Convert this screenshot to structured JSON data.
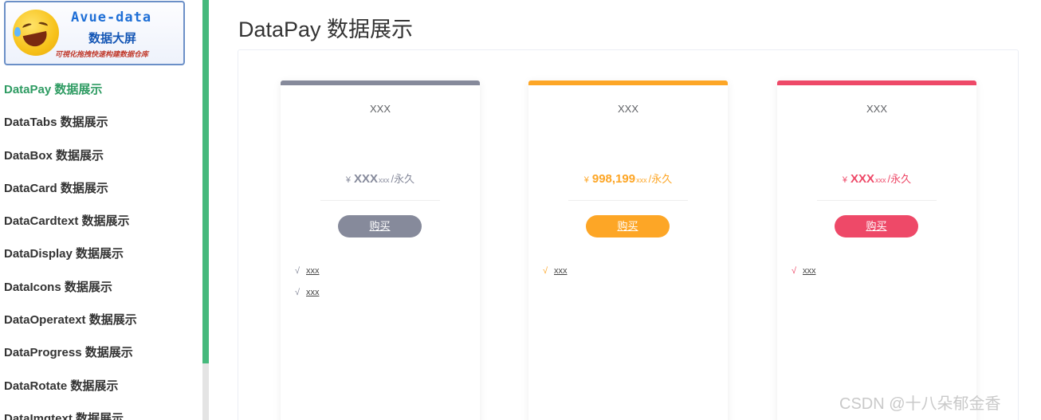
{
  "logo": {
    "title": "Avue-data",
    "subtitle": "数据大屏",
    "slogan": "可視化拖拽快速构建数据仓库"
  },
  "menu": {
    "items": [
      {
        "label": "DataPay 数据展示",
        "active": true
      },
      {
        "label": "DataTabs 数据展示",
        "active": false
      },
      {
        "label": "DataBox 数据展示",
        "active": false
      },
      {
        "label": "DataCard 数据展示",
        "active": false
      },
      {
        "label": "DataCardtext 数据展示",
        "active": false
      },
      {
        "label": "DataDisplay 数据展示",
        "active": false
      },
      {
        "label": "DataIcons 数据展示",
        "active": false
      },
      {
        "label": "DataOperatext 数据展示",
        "active": false
      },
      {
        "label": "DataProgress 数据展示",
        "active": false
      },
      {
        "label": "DataRotate 数据展示",
        "active": false
      },
      {
        "label": "DataImgtext 数据展示",
        "active": false
      }
    ]
  },
  "page": {
    "title": "DataPay 数据展示"
  },
  "colors": {
    "accent": "#2e9b62",
    "scrollbar": "#45b97c",
    "card1": "#868a9b",
    "card2": "#fda626",
    "card3": "#ee4968"
  },
  "cards": [
    {
      "title": "XXX",
      "symbol": "¥",
      "price": "XXX",
      "unit": "xxx",
      "per": "/永久",
      "button": "购买",
      "features": [
        {
          "check": "√",
          "text": "xxx"
        },
        {
          "check": "√",
          "text": "xxx"
        }
      ]
    },
    {
      "title": "XXX",
      "symbol": "¥",
      "price": "998,199",
      "unit": "xxx",
      "per": "/永久",
      "button": "购买",
      "features": [
        {
          "check": "√",
          "text": "xxx"
        }
      ]
    },
    {
      "title": "XXX",
      "symbol": "¥",
      "price": "XXX",
      "unit": "xxx",
      "per": "/永久",
      "button": "购买",
      "features": [
        {
          "check": "√",
          "text": "xxx"
        }
      ]
    }
  ],
  "watermark": "CSDN @十八朵郁金香"
}
